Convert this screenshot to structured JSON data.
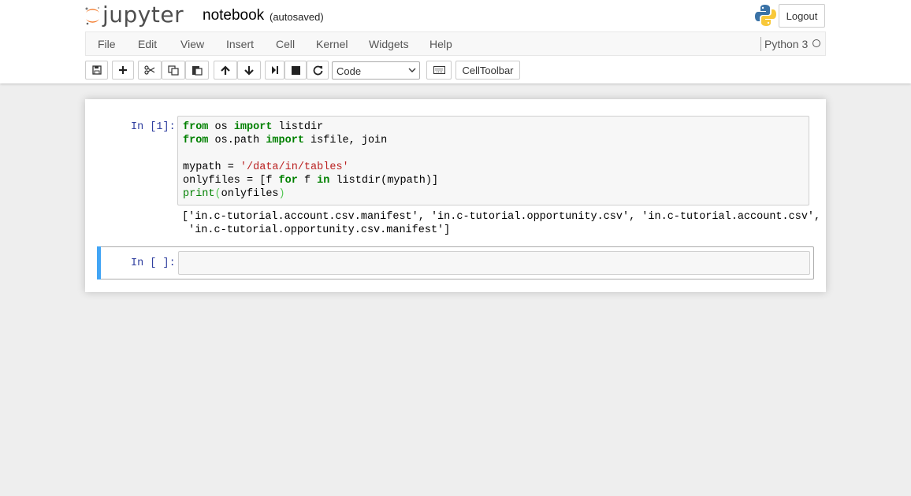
{
  "header": {
    "logo_text": "jupyter",
    "notebook_name": "notebook",
    "save_status": "(autosaved)",
    "logout_label": "Logout"
  },
  "menu": {
    "items": [
      "File",
      "Edit",
      "View",
      "Insert",
      "Cell",
      "Kernel",
      "Widgets",
      "Help"
    ],
    "kernel_name": "Python 3"
  },
  "toolbar": {
    "cell_type": "Code",
    "celltoolbar_label": "CellToolbar",
    "icons": [
      "save-icon",
      "plus-icon",
      "cut-icon",
      "copy-icon",
      "paste-icon",
      "arrow-up-icon",
      "arrow-down-icon",
      "run-step-icon",
      "stop-icon",
      "restart-icon",
      "keyboard-icon"
    ]
  },
  "cells": {
    "first": {
      "prompt": "In [1]:",
      "code": [
        "from os import listdir",
        "from os.path import isfile, join",
        "",
        "mypath = '/data/in/tables'",
        "onlyfiles = [f for f in listdir(mypath)]",
        "print(onlyfiles)"
      ],
      "output": [
        "['in.c-tutorial.account.csv.manifest', 'in.c-tutorial.opportunity.csv', 'in.c-tutorial.account.csv',",
        " 'in.c-tutorial.opportunity.csv.manifest']"
      ]
    },
    "second": {
      "prompt": "In [ ]:",
      "code": ""
    }
  },
  "colors": {
    "keyword": "#008000",
    "string": "#ba2121",
    "prompt": "#303f9f",
    "selected_cell_bar": "#42a5f5",
    "logo_orange": "#f37726"
  }
}
